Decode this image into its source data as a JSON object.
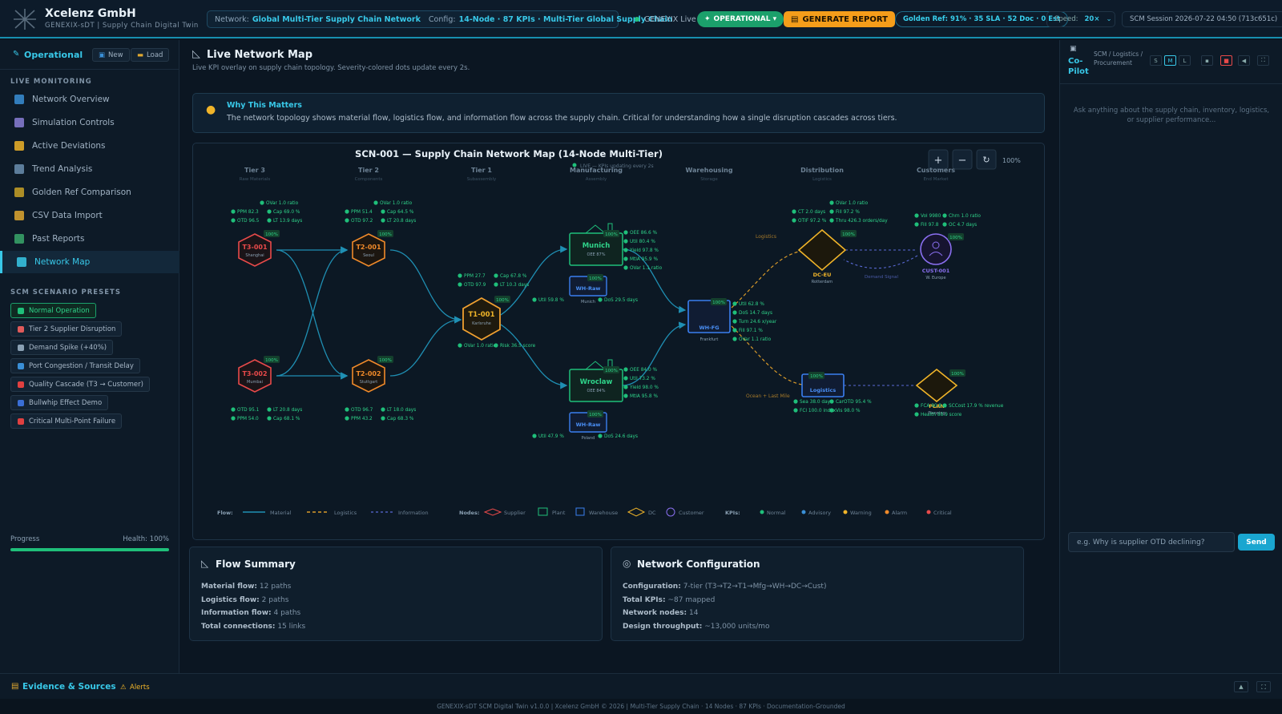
{
  "header": {
    "company": "Xcelenz GmbH",
    "subtitle": "GENEXIX-sDT | Supply Chain Digital Twin",
    "network_label": "Network:",
    "network_value": "Global Multi-Tier Supply Chain Network",
    "config_label": "Config:",
    "config_value": "14-Node · 87 KPIs · Multi-Tier Global Supply Chain",
    "live_label": "GENEXIX Live",
    "status": "OPERATIONAL ▾",
    "generate": "GENERATE REPORT",
    "golden": "Golden Ref: 91% · 35 SLA · 52 Doc · 0 Est",
    "speed_label": "Speed:",
    "speed_value": "20×",
    "session": "SCM Session 2026-07-22 04:50 (713c651c)"
  },
  "sidebar": {
    "mode": "Operational",
    "new_btn": "New",
    "load_btn": "Load",
    "live_heading": "LIVE MONITORING",
    "items": [
      {
        "label": "Network Overview",
        "color": "#3a8fd6"
      },
      {
        "label": "Simulation Controls",
        "color": "#8a7fd6"
      },
      {
        "label": "Active Deviations",
        "color": "#f0b429"
      },
      {
        "label": "Trend Analysis",
        "color": "#6b8fb0"
      },
      {
        "label": "Golden Ref Comparison",
        "color": "#c9a227"
      },
      {
        "label": "CSV Data Import",
        "color": "#e0a830"
      },
      {
        "label": "Past Reports",
        "color": "#3aa86b"
      },
      {
        "label": "Network Map",
        "color": "#38c8e8"
      }
    ],
    "presets_heading": "SCM SCENARIO PRESETS",
    "presets": [
      {
        "label": "Normal Operation",
        "color": "#1fbf7a"
      },
      {
        "label": "Tier 2 Supplier Disruption",
        "color": "#e05a5a"
      },
      {
        "label": "Demand Spike (+40%)",
        "color": "#8aa0b3"
      },
      {
        "label": "Port Congestion / Transit Delay",
        "color": "#3a8fd6"
      },
      {
        "label": "Quality Cascade (T3 → Customer)",
        "color": "#e04040"
      },
      {
        "label": "Bullwhip Effect Demo",
        "color": "#3a6fd6"
      },
      {
        "label": "Critical Multi-Point Failure",
        "color": "#e04040"
      }
    ],
    "progress_label": "Progress",
    "health_label": "Health: 100%",
    "progress": 1.0
  },
  "main": {
    "title": "Live Network Map",
    "subtitle": "Live KPI overlay on supply chain topology. Severity-colored dots update every 2s.",
    "why_title": "Why This Matters",
    "why_text": "The network topology shows material flow, logistics flow, and information flow across the supply chain. Critical for understanding how a single disruption cascades across tiers.",
    "map_title": "SCN-001 — Supply Chain Network Map (14-Node Multi-Tier)",
    "map_live": "LIVE — KPIs updating every 2s",
    "zoom": "100%",
    "tiers": [
      {
        "name": "Tier 3",
        "sub": "Raw Materials"
      },
      {
        "name": "Tier 2",
        "sub": "Components"
      },
      {
        "name": "Tier 1",
        "sub": "Subassembly"
      },
      {
        "name": "Manufacturing",
        "sub": "Assembly"
      },
      {
        "name": "Warehousing",
        "sub": "Storage"
      },
      {
        "name": "Distribution",
        "sub": "Logistics"
      },
      {
        "name": "Customers",
        "sub": "End Market"
      }
    ],
    "nodes": {
      "t3001": {
        "id": "T3-001",
        "loc": "Shanghai",
        "pct": "100%"
      },
      "t3002": {
        "id": "T3-002",
        "loc": "Mumbai",
        "pct": "100%"
      },
      "t2001": {
        "id": "T2-001",
        "loc": "Seoul",
        "pct": "100%"
      },
      "t2002": {
        "id": "T2-002",
        "loc": "Stuttgart",
        "pct": "100%"
      },
      "t1001": {
        "id": "T1-001",
        "loc": "Karlsruhe",
        "pct": "100%"
      },
      "munich": {
        "id": "Munich",
        "sub": "OEE 87%",
        "pct": "100%"
      },
      "wroclaw": {
        "id": "Wroclaw",
        "sub": "OEE 84%",
        "pct": "100%"
      },
      "whraw1": {
        "id": "WH-Raw",
        "loc": "Munich",
        "pct": "100%"
      },
      "whraw2": {
        "id": "WH-Raw",
        "loc": "Poland",
        "pct": "100%"
      },
      "whfg": {
        "id": "WH-FG",
        "loc": "Frankfurt",
        "pct": "100%"
      },
      "dceu": {
        "id": "DC-EU",
        "loc": "Rotterdam",
        "pct": "100%"
      },
      "logistics": {
        "id": "Logistics",
        "pct": "100%"
      },
      "plan": {
        "id": "PLAN",
        "loc": "Planning",
        "pct": "100%"
      },
      "cust": {
        "id": "CUST-001",
        "loc": "W. Europe",
        "pct": "100%"
      }
    },
    "edge_labels": {
      "logistics": "Logistics",
      "ocean": "Ocean + Last Mile",
      "demand": "Demand Signal"
    },
    "kpis": {
      "t3001": [
        "OVar 1.0 ratio",
        "PPM 82.3",
        "Cap 69.0 %",
        "OTD 96.5",
        "LT 13.9 days"
      ],
      "t2001": [
        "OVar 1.0 ratio",
        "PPM 51.4",
        "Cap 64.5 %",
        "OTD 97.2",
        "LT 20.8 days"
      ],
      "t3002": [
        "OTD 95.1",
        "LT 20.8 days",
        "PPM 54.0",
        "Cap 68.1 %"
      ],
      "t2002": [
        "OTD 96.7",
        "LT 18.0 days",
        "PPM 43.2",
        "Cap 68.3 %"
      ],
      "t1001": [
        "PPM 27.7",
        "Cap 67.8 %",
        "OTD 97.9",
        "LT 10.3 days",
        "OVar 1.0 ratio",
        "Risk 36.5 score"
      ],
      "munich": [
        "OEE 86.6 %",
        "Util 80.4 %",
        "Yield 97.8 %",
        "MtlA 95.9 %",
        "OVar 1.1 ratio"
      ],
      "whraw1": [
        "Util 59.8 %",
        "DoS 29.5 days"
      ],
      "wroclaw": [
        "OEE 84.0 %",
        "Util 73.2 %",
        "Yield 98.0 %",
        "MtlA 95.8 %"
      ],
      "whraw2": [
        "Util 47.9 %",
        "DoS 24.6 days"
      ],
      "whfg": [
        "Util 62.8 %",
        "DoS 14.7 days",
        "Turn 24.6 x/year",
        "Fill 97.1 %",
        "OVar 1.1 ratio"
      ],
      "dceu": [
        "OVar 1.0 ratio",
        "CT 2.0 days",
        "Fill 97.2 %",
        "OTIF 97.2 %",
        "Thru 426.3 orders/day"
      ],
      "cust": [
        "Vol 9980",
        "Chrn 1.0 ratio",
        "Fill 97.8",
        "OC 4.7 days"
      ],
      "logistics": [
        "Sea 38.0 days",
        "CarOTD 95.4 %",
        "FCI 100.0 index",
        "Vis 98.0 %"
      ],
      "plan": [
        "FCA 90.8",
        "SCCost 17.9 % revenue",
        "Health 88.9 score"
      ]
    },
    "legend": {
      "flow_label": "Flow:",
      "material": "Material",
      "logistics": "Logistics",
      "information": "Information",
      "nodes_label": "Nodes:",
      "supplier": "Supplier",
      "plant": "Plant",
      "warehouse": "Warehouse",
      "dc": "DC",
      "customer": "Customer",
      "kpis_label": "KPIs:",
      "normal": "Normal",
      "advisory": "Advisory",
      "warning": "Warning",
      "alarm": "Alarm",
      "critical": "Critical"
    },
    "flow_summary": {
      "title": "Flow Summary",
      "rows": [
        {
          "k": "Material flow:",
          "v": "12 paths"
        },
        {
          "k": "Logistics flow:",
          "v": "2 paths"
        },
        {
          "k": "Information flow:",
          "v": "4 paths"
        },
        {
          "k": "Total connections:",
          "v": "15 links"
        }
      ]
    },
    "net_config": {
      "title": "Network Configuration",
      "rows": [
        {
          "k": "Configuration:",
          "v": "7-tier (T3→T2→T1→Mfg→WH→DC→Cust)"
        },
        {
          "k": "Total KPIs:",
          "v": "~87 mapped"
        },
        {
          "k": "Network nodes:",
          "v": "14"
        },
        {
          "k": "Design throughput:",
          "v": "~13,000 units/mo"
        }
      ]
    }
  },
  "copilot": {
    "title": "Co-Pilot",
    "crumb": "SCM / Logistics / Procurement",
    "sizes": [
      "S",
      "M",
      "L"
    ],
    "placeholder_text": "Ask anything about the supply chain, inventory, logistics, or supplier performance...",
    "input_placeholder": "e.g. Why is supplier OTD declining?",
    "send": "Send"
  },
  "footer": {
    "evidence": "Evidence & Sources",
    "alerts": "Alerts",
    "copyright": "GENEXIX-sDT SCM Digital Twin v1.0.0 | Xcelenz GmbH © 2026 | Multi-Tier Supply Chain · 14 Nodes · 87 KPIs · Documentation-Grounded"
  },
  "colors": {
    "accent": "#38c8e8",
    "normal": "#1fbf7a",
    "supplier_red": "#e84a4a",
    "supplier_orange": "#f08a2a",
    "dc": "#f0b429",
    "warehouse": "#3a7ff0",
    "customer": "#8a6ff0"
  }
}
